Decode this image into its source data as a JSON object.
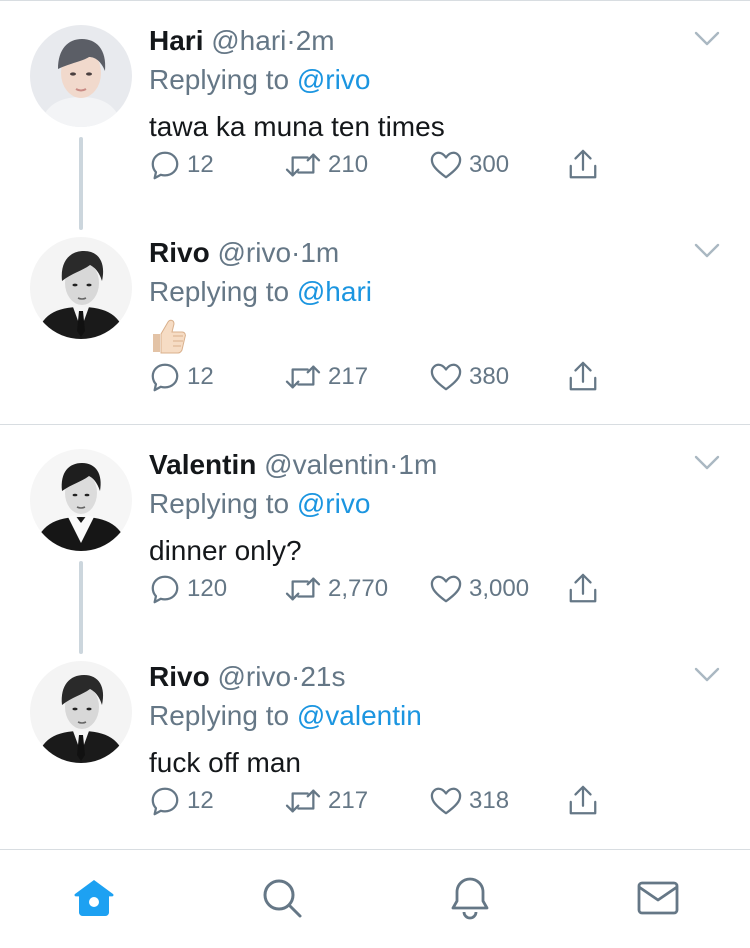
{
  "tweets": [
    {
      "name": "Hari",
      "handle": "@hari",
      "time": "2m",
      "replying_label": "Replying to",
      "replying_to": "@rivo",
      "text": "tawa ka muna ten times",
      "replies": "12",
      "retweets": "210",
      "likes": "300",
      "avatar": "portrait-light"
    },
    {
      "name": "Rivo",
      "handle": "@rivo",
      "time": "1m",
      "replying_label": "Replying to",
      "replying_to": "@hari",
      "text": "",
      "emoji": "thumbs-up-light-skin",
      "replies": "12",
      "retweets": "217",
      "likes": "380",
      "avatar": "portrait-bw-suit"
    },
    {
      "name": "Valentin",
      "handle": "@valentin",
      "time": "1m",
      "replying_label": "Replying to",
      "replying_to": "@rivo",
      "text": "dinner only?",
      "replies": "120",
      "retweets": "2,770",
      "likes": "3,000",
      "avatar": "portrait-bw-coat"
    },
    {
      "name": "Rivo",
      "handle": "@rivo",
      "time": "21s",
      "replying_label": "Replying to",
      "replying_to": "@valentin",
      "text": "fuck off man",
      "replies": "12",
      "retweets": "217",
      "likes": "318",
      "avatar": "portrait-bw-suit"
    }
  ],
  "dot": "·",
  "colors": {
    "accent": "#1b95e0",
    "muted": "#657786",
    "text": "#14171a",
    "border": "#d8dde1",
    "thread": "#ccd6dd"
  },
  "tabbar": [
    {
      "name": "home",
      "icon": "home-icon",
      "active": true
    },
    {
      "name": "search",
      "icon": "search-icon",
      "active": false
    },
    {
      "name": "notifications",
      "icon": "bell-icon",
      "active": false
    },
    {
      "name": "messages",
      "icon": "mail-icon",
      "active": false
    }
  ]
}
